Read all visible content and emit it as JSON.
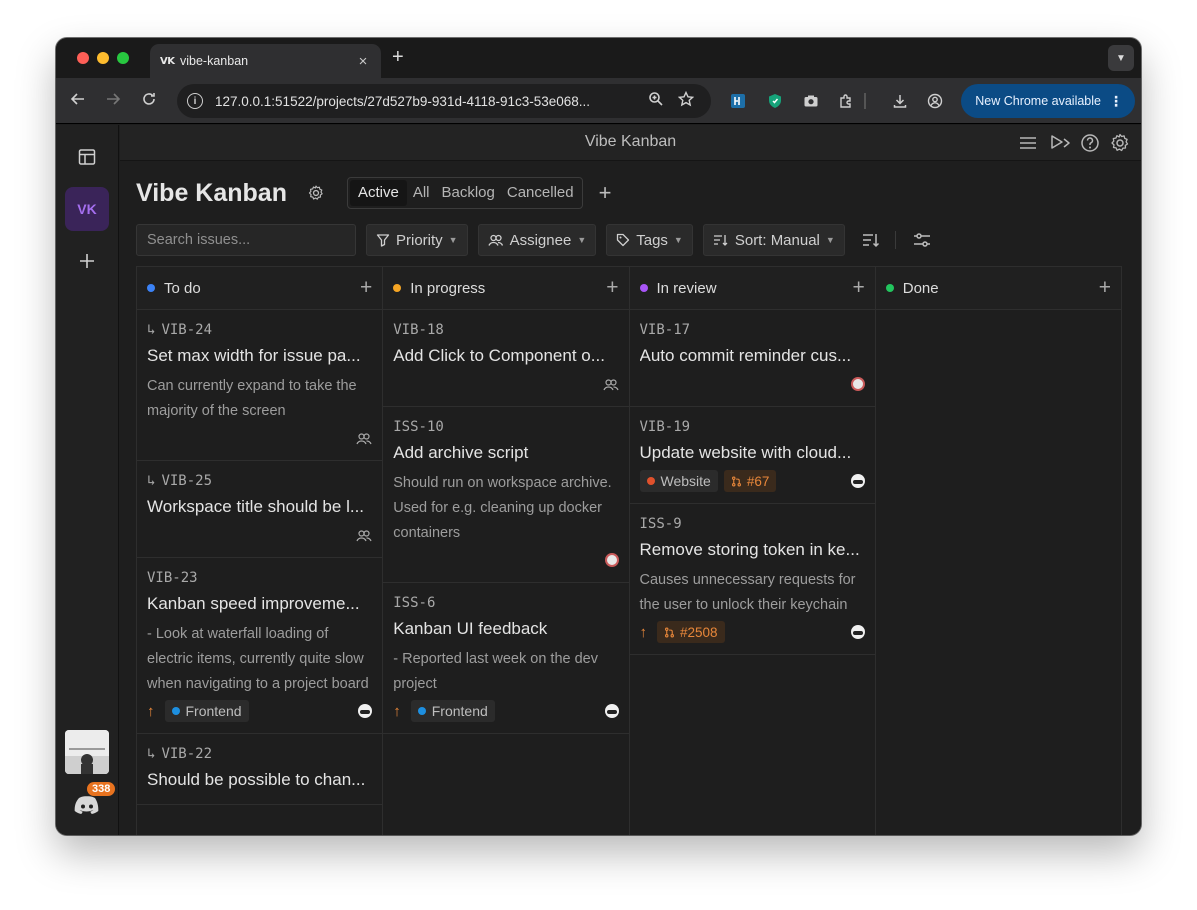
{
  "browser": {
    "tab_favicon": "VK",
    "tab_title": "vibe-kanban",
    "url": "127.0.0.1:51522/projects/27d527b9-931d-4118-91c3-53e068...",
    "update_label": "New Chrome available"
  },
  "rail": {
    "project_initials": "VK",
    "badge_count": "338"
  },
  "topbar": {
    "title": "Vibe Kanban"
  },
  "project": {
    "title": "Vibe Kanban",
    "views": [
      "Active",
      "All",
      "Backlog",
      "Cancelled"
    ],
    "active_view": "Active"
  },
  "filters": {
    "search_placeholder": "Search issues...",
    "priority": "Priority",
    "assignee": "Assignee",
    "tags": "Tags",
    "sort": "Sort: Manual"
  },
  "colors": {
    "todo": "#3b82f6",
    "in_progress": "#f5a524",
    "in_review": "#a855f7",
    "done": "#22c55e",
    "frontend_tag": "#1d8fe0",
    "website_tag": "#e0512c",
    "accent_orange": "#e8873a"
  },
  "columns": [
    {
      "name": "To do",
      "cards": [
        {
          "id": "VIB-24",
          "sub": true,
          "title": "Set max width for issue pa...",
          "desc": "Can currently expand to take the majority of the screen",
          "priority": "",
          "tag": "",
          "pr": "",
          "avatar": "group"
        },
        {
          "id": "VIB-25",
          "sub": true,
          "title": "Workspace title should be l...",
          "desc": "",
          "priority": "",
          "tag": "",
          "pr": "",
          "avatar": "group"
        },
        {
          "id": "VIB-23",
          "sub": false,
          "title": "Kanban speed improveme...",
          "desc": "- Look at waterfall loading of electric items, currently quite slow when navigating to a project board",
          "priority": "↑",
          "tag": "Frontend",
          "pr": "",
          "avatar": "mono"
        },
        {
          "id": "VIB-22",
          "sub": true,
          "title": "Should be possible to chan...",
          "desc": "",
          "priority": "",
          "tag": "",
          "pr": "",
          "avatar": ""
        }
      ]
    },
    {
      "name": "In progress",
      "cards": [
        {
          "id": "VIB-18",
          "sub": false,
          "title": "Add Click to Component o...",
          "desc": "",
          "priority": "",
          "tag": "",
          "pr": "",
          "avatar": "group"
        },
        {
          "id": "ISS-10",
          "sub": false,
          "title": "Add archive script",
          "desc": "Should run on workspace archive. Used for e.g. cleaning up docker containers",
          "priority": "",
          "tag": "",
          "pr": "",
          "avatar": "red"
        },
        {
          "id": "ISS-6",
          "sub": false,
          "title": "Kanban UI feedback",
          "desc": "- Reported last week on the dev project",
          "priority": "↑",
          "tag": "Frontend",
          "pr": "",
          "avatar": "mono"
        }
      ]
    },
    {
      "name": "In review",
      "cards": [
        {
          "id": "VIB-17",
          "sub": false,
          "title": "Auto commit reminder cus...",
          "desc": "",
          "priority": "",
          "tag": "",
          "pr": "",
          "avatar": "red"
        },
        {
          "id": "VIB-19",
          "sub": false,
          "title": "Update website with cloud...",
          "desc": "",
          "priority": "",
          "tag": "Website",
          "pr": "#67",
          "avatar": "mono"
        },
        {
          "id": "ISS-9",
          "sub": false,
          "title": "Remove storing token in ke...",
          "desc": "Causes unnecessary requests for the user to unlock their keychain",
          "priority": "↑",
          "tag": "",
          "pr": "#2508",
          "avatar": "mono"
        }
      ]
    },
    {
      "name": "Done",
      "cards": []
    }
  ]
}
